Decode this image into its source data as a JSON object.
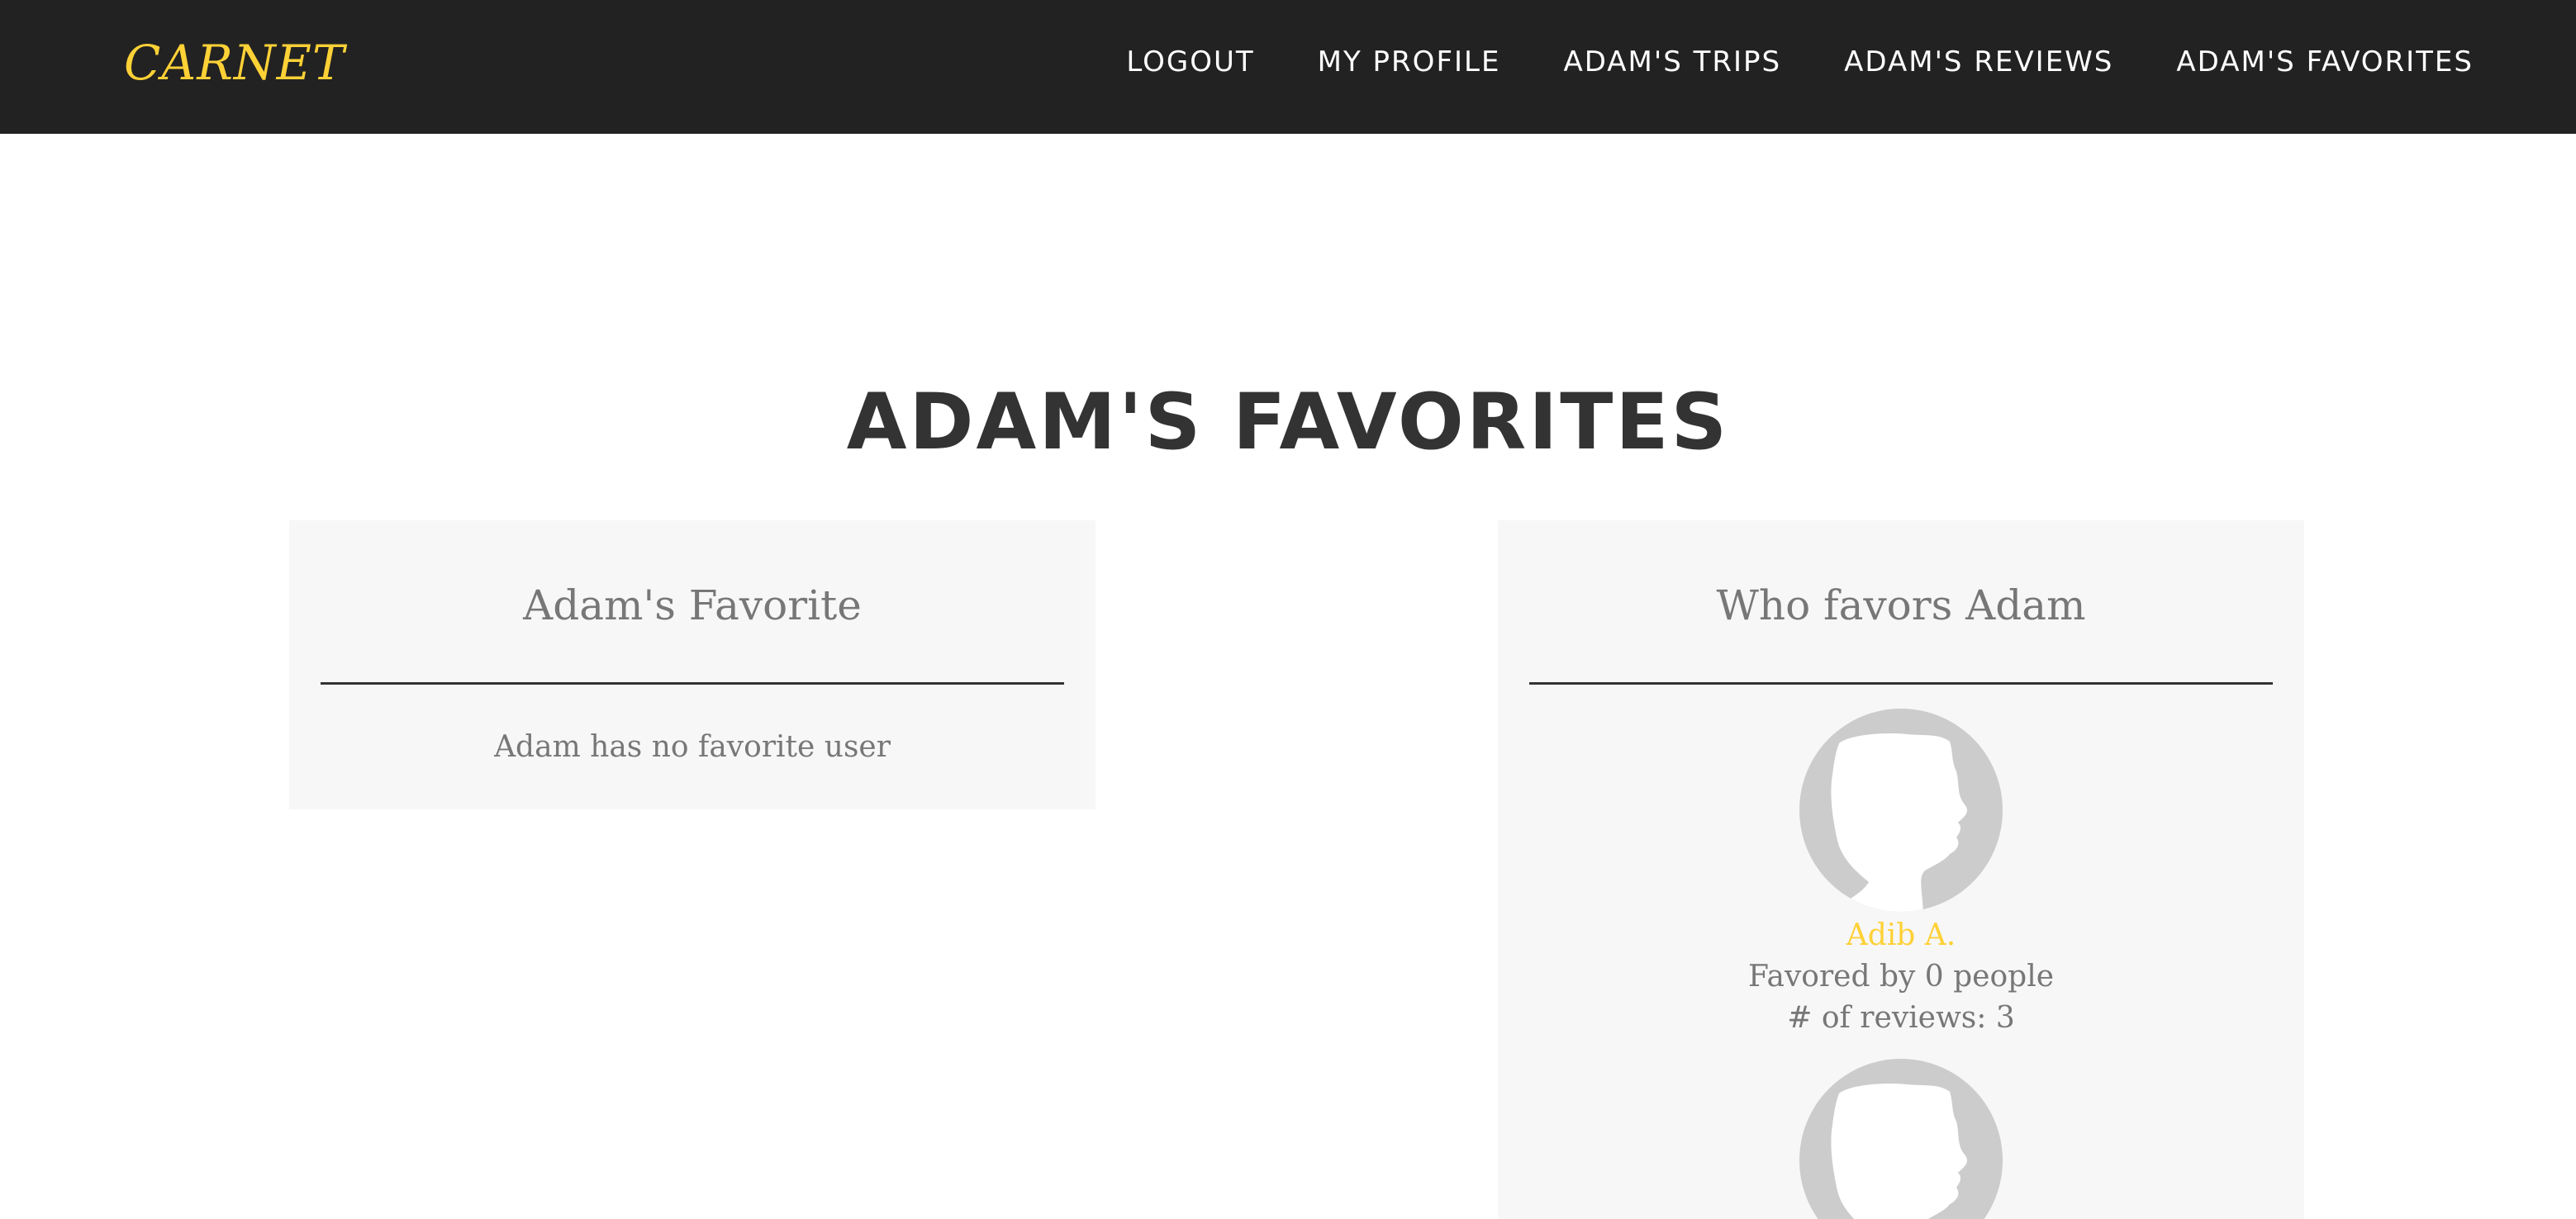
{
  "navbar": {
    "brand": "CARNET",
    "links": [
      {
        "label": "LOGOUT"
      },
      {
        "label": "MY PROFILE"
      },
      {
        "label": "ADAM'S TRIPS"
      },
      {
        "label": "ADAM'S REVIEWS"
      },
      {
        "label": "ADAM'S FAVORITES"
      }
    ]
  },
  "page": {
    "title": "ADAM'S FAVORITES"
  },
  "favorites_panel": {
    "heading": "Adam's Favorite",
    "empty_message": "Adam has no favorite user"
  },
  "favored_by_panel": {
    "heading": "Who favors Adam",
    "users": [
      {
        "name": "Adib A.",
        "favored_by": "Favored by 0 people",
        "reviews": "# of reviews: 3",
        "avatar_icon": "user-silhouette-icon"
      },
      {
        "avatar_icon": "user-silhouette-icon"
      }
    ]
  },
  "colors": {
    "navbar_bg": "#222222",
    "brand": "#fed136",
    "accent": "#fed136",
    "panel_bg": "#f7f7f7",
    "title": "#333333",
    "muted_text": "#777777",
    "avatar": "#cccccc"
  }
}
